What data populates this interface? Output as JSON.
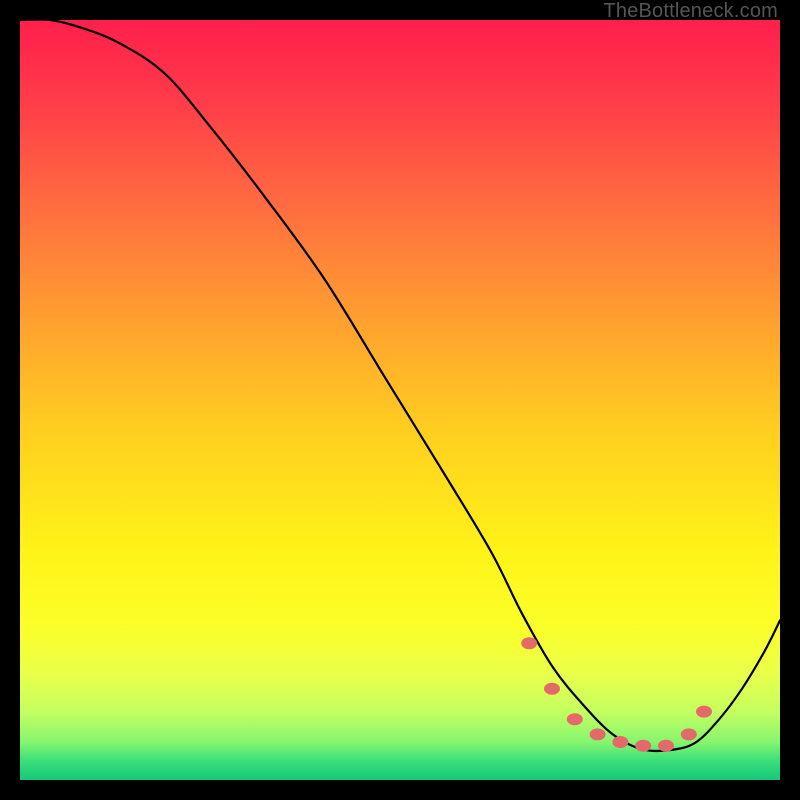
{
  "watermark": "TheBottleneck.com",
  "chart_data": {
    "type": "line",
    "title": "",
    "xlabel": "",
    "ylabel": "",
    "xlim": [
      0,
      100
    ],
    "ylim": [
      0,
      100
    ],
    "grid": false,
    "legend": false,
    "description": "Bottleneck-style curve on a vertical red→yellow→green gradient background. Curve descends steeply from top-left, reaches a flat minimum around x≈70–88, then rises toward the right edge. Salmon dots mark points near the minimum.",
    "background_gradient_stops": [
      {
        "offset": 0.0,
        "color": "#ff1f4b"
      },
      {
        "offset": 0.1,
        "color": "#ff3a4a"
      },
      {
        "offset": 0.25,
        "color": "#ff6e3f"
      },
      {
        "offset": 0.4,
        "color": "#ffa22f"
      },
      {
        "offset": 0.55,
        "color": "#ffd11f"
      },
      {
        "offset": 0.7,
        "color": "#fff318"
      },
      {
        "offset": 0.8,
        "color": "#fbff2a"
      },
      {
        "offset": 0.86,
        "color": "#eaff4a"
      },
      {
        "offset": 0.91,
        "color": "#c4ff60"
      },
      {
        "offset": 0.95,
        "color": "#86f56e"
      },
      {
        "offset": 0.975,
        "color": "#3adf7a"
      },
      {
        "offset": 1.0,
        "color": "#17c77a"
      }
    ],
    "series": [
      {
        "name": "bottleneck-curve",
        "x": [
          0,
          4,
          8,
          13,
          19,
          25,
          32,
          40,
          48,
          56,
          62,
          66,
          70,
          74,
          78,
          82,
          86,
          89,
          92,
          95,
          98,
          100
        ],
        "values": [
          100,
          100,
          99,
          97,
          93,
          86,
          77,
          66,
          53,
          40,
          30,
          22,
          15,
          10,
          6,
          4,
          4,
          5,
          8,
          12,
          17,
          21
        ]
      }
    ],
    "min_markers": {
      "name": "minimum-dots",
      "x": [
        67,
        70,
        73,
        76,
        79,
        82,
        85,
        88,
        90
      ],
      "values": [
        18,
        12,
        8,
        6,
        5,
        4.5,
        4.5,
        6,
        9
      ]
    }
  }
}
